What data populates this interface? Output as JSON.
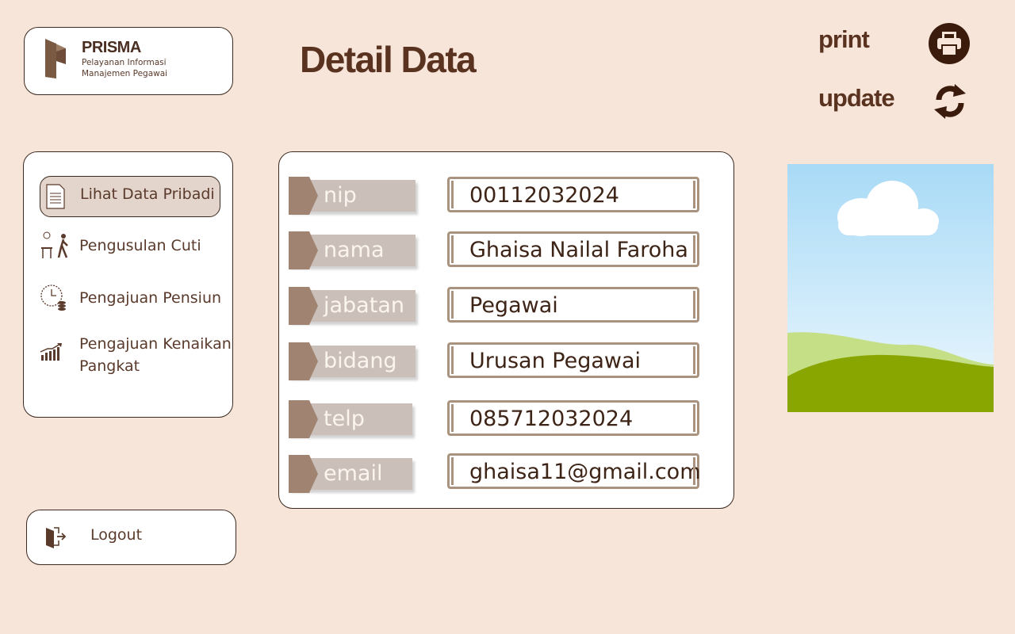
{
  "brand": {
    "name": "PRISMA",
    "subtitle_line1": "Pelayanan Informasi",
    "subtitle_line2": "Manajemen Pegawai"
  },
  "page_title": "Detail Data",
  "actions": {
    "print_label": "print",
    "update_label": "update"
  },
  "sidebar": {
    "items": [
      {
        "label": "Lihat Data Pribadi",
        "icon": "document-icon",
        "active": true
      },
      {
        "label": "Pengusulan Cuti",
        "icon": "leave-person-icon",
        "active": false
      },
      {
        "label": "Pengajuan Pensiun",
        "icon": "clock-coins-icon",
        "active": false
      },
      {
        "label_line1": "Pengajuan Kenaikan",
        "label_line2": "Pangkat",
        "icon": "growth-chart-icon",
        "active": false
      }
    ]
  },
  "logout": {
    "label": "Logout",
    "icon": "logout-door-icon"
  },
  "fields": [
    {
      "label": "nip",
      "value": "00112032024"
    },
    {
      "label": "nama",
      "value": "Ghaisa Nailal Faroha"
    },
    {
      "label": "jabatan",
      "value": "Pegawai"
    },
    {
      "label": "bidang",
      "value": "Urusan Pegawai"
    },
    {
      "label": "telp",
      "value": "085712032024"
    },
    {
      "label": "email",
      "value": "ghaisa11@gmail.com"
    }
  ],
  "colors": {
    "background": "#f8e5d9",
    "accent_dark": "#3b1c0c",
    "tag_arrow": "#a08370",
    "tag_body": "#cbc0b9",
    "value_border": "#a9927e"
  }
}
